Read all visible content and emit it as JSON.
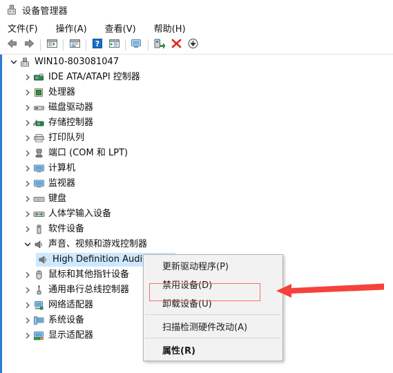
{
  "window": {
    "title": "设备管理器",
    "icon": "device-manager-icon"
  },
  "menubar": {
    "items": [
      {
        "label": "文件(F)",
        "name": "menu-file"
      },
      {
        "label": "操作(A)",
        "name": "menu-action"
      },
      {
        "label": "查看(V)",
        "name": "menu-view"
      },
      {
        "label": "帮助(H)",
        "name": "menu-help"
      }
    ]
  },
  "toolbar": {
    "buttons": [
      {
        "icon": "back-arrow-icon",
        "name": "toolbar-back"
      },
      {
        "icon": "forward-arrow-icon",
        "name": "toolbar-forward"
      },
      {
        "icon": "show-hide-console-tree-icon",
        "name": "toolbar-console-tree"
      },
      {
        "icon": "properties-icon",
        "name": "toolbar-properties"
      },
      {
        "icon": "help-icon",
        "name": "toolbar-help"
      },
      {
        "icon": "view-details-icon",
        "name": "toolbar-view-details"
      },
      {
        "icon": "scan-hardware-changes-icon",
        "name": "toolbar-scan-hardware"
      },
      {
        "icon": "update-driver-icon",
        "name": "toolbar-update-driver"
      },
      {
        "icon": "uninstall-device-icon",
        "name": "toolbar-uninstall-device"
      },
      {
        "icon": "disable-device-icon",
        "name": "toolbar-disable-device"
      }
    ]
  },
  "tree": {
    "root": {
      "label": "WIN10-803081047",
      "icon": "computer-root-icon",
      "expanded": true,
      "twisty": "chevron-down"
    },
    "nodes": [
      {
        "label": "IDE ATA/ATAPI 控制器",
        "icon": "ide-controller-icon",
        "twisty": "chevron-right",
        "level": 1,
        "selected": false
      },
      {
        "label": "处理器",
        "icon": "processor-icon",
        "twisty": "chevron-right",
        "level": 1,
        "selected": false
      },
      {
        "label": "磁盘驱动器",
        "icon": "disk-drive-icon",
        "twisty": "chevron-right",
        "level": 1,
        "selected": false
      },
      {
        "label": "存储控制器",
        "icon": "storage-controller-icon",
        "twisty": "chevron-right",
        "level": 1,
        "selected": false
      },
      {
        "label": "打印队列",
        "icon": "print-queue-icon",
        "twisty": "chevron-right",
        "level": 1,
        "selected": false
      },
      {
        "label": "端口 (COM 和 LPT)",
        "icon": "ports-icon",
        "twisty": "chevron-right",
        "level": 1,
        "selected": false
      },
      {
        "label": "计算机",
        "icon": "computer-icon",
        "twisty": "chevron-right",
        "level": 1,
        "selected": false
      },
      {
        "label": "监视器",
        "icon": "monitor-icon",
        "twisty": "chevron-right",
        "level": 1,
        "selected": false
      },
      {
        "label": "键盘",
        "icon": "keyboard-icon",
        "twisty": "chevron-right",
        "level": 1,
        "selected": false
      },
      {
        "label": "人体学输入设备",
        "icon": "hid-icon",
        "twisty": "chevron-right",
        "level": 1,
        "selected": false
      },
      {
        "label": "软件设备",
        "icon": "software-device-icon",
        "twisty": "chevron-right",
        "level": 1,
        "selected": false
      },
      {
        "label": "声音、视频和游戏控制器",
        "icon": "sound-video-game-icon",
        "twisty": "chevron-down",
        "level": 1,
        "selected": false
      },
      {
        "label": "High Definition Audio 设备",
        "icon": "audio-device-icon",
        "twisty": "none",
        "level": 2,
        "selected": true
      },
      {
        "label": "鼠标和其他指针设备",
        "icon": "mouse-icon",
        "twisty": "chevron-right",
        "level": 1,
        "selected": false
      },
      {
        "label": "通用串行总线控制器",
        "icon": "usb-controller-icon",
        "twisty": "chevron-right",
        "level": 1,
        "selected": false
      },
      {
        "label": "网络适配器",
        "icon": "network-adapter-icon",
        "twisty": "chevron-right",
        "level": 1,
        "selected": false
      },
      {
        "label": "系统设备",
        "icon": "system-device-icon",
        "twisty": "chevron-right",
        "level": 1,
        "selected": false
      },
      {
        "label": "显示适配器",
        "icon": "display-adapter-icon",
        "twisty": "chevron-right",
        "level": 1,
        "selected": false
      }
    ]
  },
  "context_menu": {
    "items": [
      {
        "label": "更新驱动程序(P)",
        "name": "ctx-update-driver",
        "bold": false,
        "separator_after": false
      },
      {
        "label": "禁用设备(D)",
        "name": "ctx-disable-device",
        "bold": false,
        "separator_after": false
      },
      {
        "label": "卸载设备(U)",
        "name": "ctx-uninstall-device",
        "bold": false,
        "separator_after": true,
        "highlighted": true
      },
      {
        "label": "扫描检测硬件改动(A)",
        "name": "ctx-scan-hardware-changes",
        "bold": false,
        "separator_after": true
      },
      {
        "label": "属性(R)",
        "name": "ctx-properties",
        "bold": true,
        "separator_after": false
      }
    ]
  },
  "annotations": {
    "highlight_color": "#f0726c",
    "arrow_color": "#f4433c",
    "selection_color": "#cde8ff",
    "accent_color": "#2b7cd3"
  }
}
